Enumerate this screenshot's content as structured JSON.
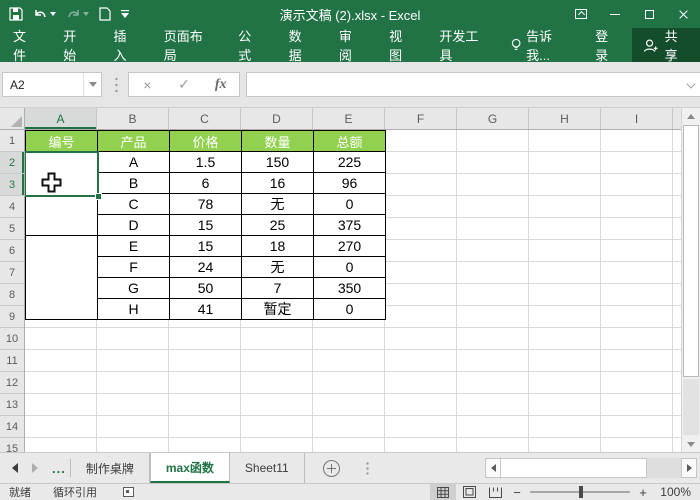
{
  "window": {
    "title": "演示文稿 (2).xlsx - Excel"
  },
  "ribbon": {
    "tabs": [
      "文件",
      "开始",
      "插入",
      "页面布局",
      "公式",
      "数据",
      "审阅",
      "视图",
      "开发工具"
    ],
    "tell_me": "告诉我...",
    "sign_in": "登录",
    "share": "共享"
  },
  "formula_bar": {
    "name_box": "A2",
    "cancel": "×",
    "confirm": "✓",
    "fx": "fx",
    "formula": ""
  },
  "grid": {
    "columns": [
      "A",
      "B",
      "C",
      "D",
      "E",
      "F",
      "G",
      "H",
      "I"
    ],
    "selected_column": "A",
    "row_numbers": [
      "1",
      "2",
      "3",
      "4",
      "5",
      "6",
      "7",
      "8",
      "9",
      "10",
      "11",
      "12",
      "13",
      "14",
      "15"
    ],
    "selected_rows": [
      "2",
      "3"
    ],
    "selected_cell": "A2",
    "table": {
      "headers": [
        "编号",
        "产品",
        "价格",
        "数量",
        "总额"
      ],
      "rows": [
        [
          "A",
          "1.5",
          "150",
          "225"
        ],
        [
          "B",
          "6",
          "16",
          "96"
        ],
        [
          "C",
          "78",
          "无",
          "0"
        ],
        [
          "D",
          "15",
          "25",
          "375"
        ],
        [
          "E",
          "15",
          "18",
          "270"
        ],
        [
          "F",
          "24",
          "无",
          "0"
        ],
        [
          "G",
          "50",
          "7",
          "350"
        ],
        [
          "H",
          "41",
          "暂定",
          "0"
        ]
      ]
    },
    "colors": {
      "accent": "#217346",
      "header_fill": "#92d050"
    }
  },
  "sheet_tabs": {
    "more": "...",
    "tabs": [
      {
        "label": "制作桌牌",
        "active": false
      },
      {
        "label": "max函数",
        "active": true
      },
      {
        "label": "Sheet11",
        "active": false
      }
    ]
  },
  "status_bar": {
    "ready": "就绪",
    "circular_refs": "循环引用",
    "zoom_out": "−",
    "zoom_in": "+",
    "zoom_level": "100%"
  }
}
